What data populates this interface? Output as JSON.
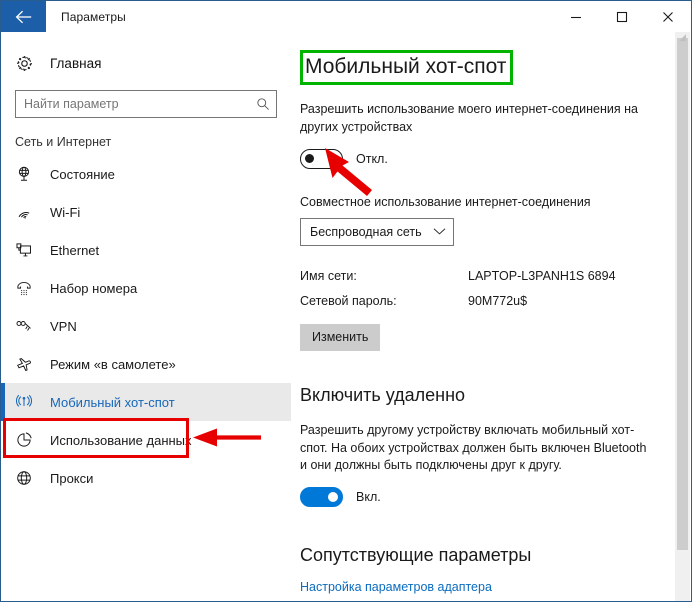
{
  "window": {
    "title": "Параметры",
    "back_icon": "back-arrow-icon",
    "minimize_label": "–",
    "maximize_label": "□",
    "close_label": "✕"
  },
  "sidebar": {
    "home": {
      "label": "Главная",
      "icon": "gear-icon"
    },
    "search": {
      "placeholder": "Найти параметр",
      "value": "",
      "icon": "search-icon"
    },
    "group_title": "Сеть и Интернет",
    "items": [
      {
        "label": "Состояние",
        "icon": "globe-status-icon",
        "selected": false
      },
      {
        "label": "Wi-Fi",
        "icon": "wifi-icon",
        "selected": false
      },
      {
        "label": "Ethernet",
        "icon": "ethernet-icon",
        "selected": false
      },
      {
        "label": "Набор номера",
        "icon": "dialup-phone-icon",
        "selected": false
      },
      {
        "label": "VPN",
        "icon": "vpn-icon",
        "selected": false
      },
      {
        "label": "Режим «в самолете»",
        "icon": "airplane-icon",
        "selected": false
      },
      {
        "label": "Мобильный хот-спот",
        "icon": "hotspot-icon",
        "selected": true
      },
      {
        "label": "Использование данных",
        "icon": "pie-chart-icon",
        "selected": false
      },
      {
        "label": "Прокси",
        "icon": "globe-icon",
        "selected": false
      }
    ]
  },
  "main": {
    "page_title": "Мобильный хот-спот",
    "share_description": "Разрешить использование моего интернет-соединения на других устройствах",
    "share_toggle": {
      "state": "off",
      "label": "Откл."
    },
    "connection_section_label": "Совместное использование интернет-соединения",
    "connection_select": {
      "value": "Беспроводная сеть",
      "chevron_icon": "chevron-down-icon"
    },
    "info": [
      {
        "key": "Имя сети:",
        "value": "LAPTOP-L3PANH1S 6894"
      },
      {
        "key": "Сетевой пароль:",
        "value": "90M772u$"
      }
    ],
    "edit_button": "Изменить",
    "remote_title": "Включить удаленно",
    "remote_description": "Разрешить другому устройству включать мобильный хот-спот. На обоих устройствах должен быть включен Bluetooth и они должны быть подключены друг к другу.",
    "remote_toggle": {
      "state": "on",
      "label": "Вкл."
    },
    "related_title": "Сопутствующие параметры",
    "related_link": "Настройка параметров адаптера"
  },
  "annotations": {
    "highlight_title_color": "#00b400",
    "highlight_nav_color": "#e60000",
    "arrow_color": "#e60000"
  },
  "theme": {
    "accent": "#0078d7",
    "titlebar_back_bg": "#1c5fa8",
    "link": "#0b6cc1",
    "selected_nav_bg": "#e9e9e9"
  }
}
